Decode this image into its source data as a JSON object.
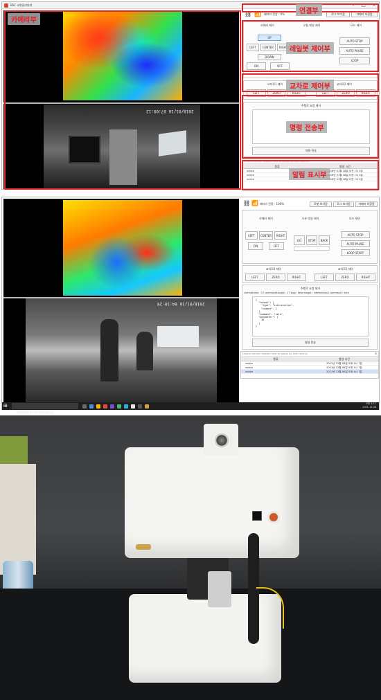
{
  "window1": {
    "title": "BSC 교량관리부쉬",
    "camera_timestamp": "2018/01/16 07:09:12",
    "connect_status": "배터리 잔량 : 0%",
    "tabs": [
      "로그 보기함",
      "카메라 저장함"
    ],
    "rail_group_labels": [
      "카메라 제어",
      "오븐 레일 제어",
      "모드 제어"
    ],
    "camera_buttons": [
      "UP",
      "LEFT",
      "CENTER",
      "RIGHT",
      "DOWN",
      "ON",
      "OFF"
    ],
    "mode_buttons": [
      "AUTO STOP",
      "AUTO PAUSE",
      "LOOP"
    ],
    "cross1_label": "교차로1 제어",
    "cross2_label": "교차로2 제어",
    "cross_buttons": [
      "LEFT",
      "ZERO",
      "RIGHT"
    ],
    "command_group_label": "주행로 요청 제어",
    "send_button": "명령 전송",
    "grid_hint": "Drag a column header here to group by that column",
    "grid_headers": [
      "종류",
      "발생 시간"
    ],
    "grid_rows": [
      {
        "type": "notice",
        "time": "2018년 01월 16일 오전 7시 0분"
      },
      {
        "type": "notice",
        "time": "2018년 01월 16일 오전 7시 0분"
      },
      {
        "type": "notice",
        "time": "2018년 01월 16일 오전 7시 0분"
      }
    ],
    "annotations": {
      "camera": "카메라부",
      "connect": "연결부",
      "rail": "레일봇 제어부",
      "cross": "교차로 제어부",
      "command": "명령 전송부",
      "alarm": "알림 표시부"
    }
  },
  "window2": {
    "camera_timestamp": "2018/01/16 04:10:28",
    "connect_status": "배터리 잔량 : 100%",
    "tabs": [
      "로봇 보기함",
      "로그 보기함",
      "카메라 저장함"
    ],
    "rail_group_labels": [
      "카메라 제어",
      "오븐 레일 제어",
      "모드 제어"
    ],
    "camera_buttons": [
      "LEFT",
      "CENTER",
      "RIGHT",
      "ON",
      "OFF"
    ],
    "rail_buttons": [
      "GO",
      "STOP",
      "BACK"
    ],
    "mode_buttons": [
      "AUTO STOP",
      "AUTO PAUSE",
      "LOOP START"
    ],
    "cross1_label": "교차로1 제어",
    "cross2_label": "교차로2 제어",
    "cross_buttons": [
      "LEFT",
      "ZERO",
      "RIGHT"
    ],
    "command_group_label": "주행로 요청 제어",
    "command_status": "currentIndex : 17 commandLength : 17 loop : false target : intersection2 command : zero",
    "command_json": "{\n  \"target\": [\n    \"type\": \"intersection\",\n    \"number\": 2\n  ],\n  \"command\": \"zero\",\n  \"parameter\": [\n    36\n  ]\n}",
    "send_button": "명령 전송",
    "grid_hint": "Drag a column header here to group by that column",
    "grid_headers": [
      "종류",
      "발생 시간"
    ],
    "grid_rows": [
      {
        "type": "notice",
        "time": "2021년 12월 06일 오후 4시 7분"
      },
      {
        "type": "notice",
        "time": "2021년 12월 06일 오후 4시 7분"
      },
      {
        "type": "notice",
        "time": "2021년 12월 06일 오후 4시 7분"
      }
    ],
    "taskbar_search": "검색하려면 여기에 입력하십시오.",
    "taskbar_clock": "오후 4:17\n2021-12-06"
  },
  "colors": {
    "annotation_red": "#e0282a",
    "panel_bg": "#fbfbfb",
    "selected_row": "#cfe0f7"
  }
}
